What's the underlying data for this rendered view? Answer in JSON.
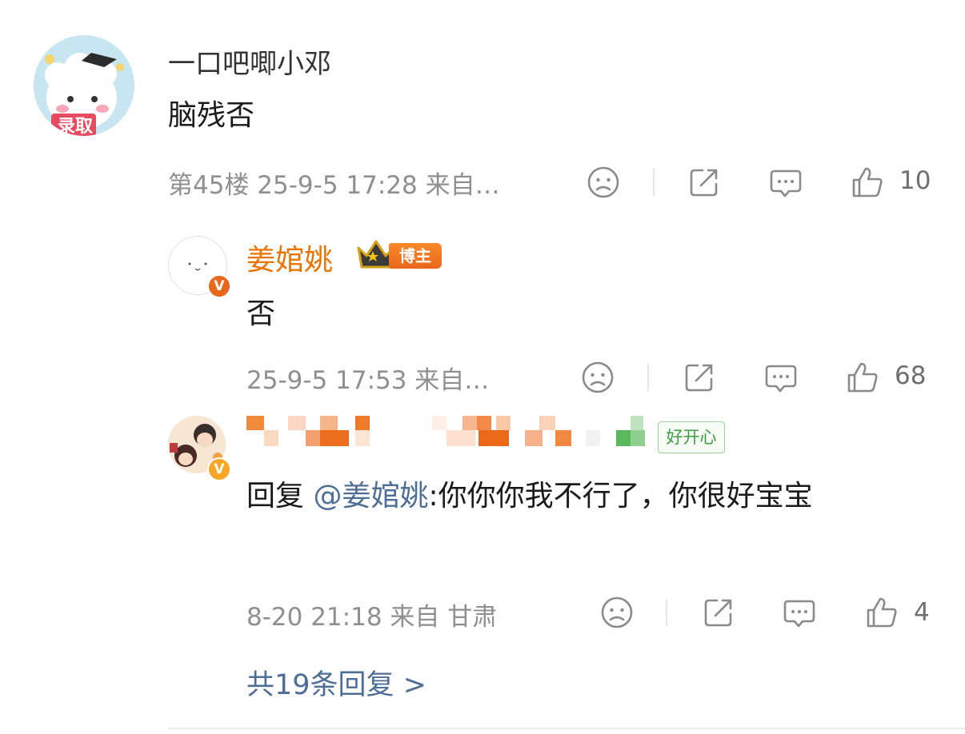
{
  "comment": {
    "author": "一口吧唧小邓",
    "avatar_text": "录取",
    "text": "脑残否",
    "meta": "第45楼 25-9-5 17:28 来自…",
    "like_count": "10"
  },
  "reply1": {
    "author": "姜婠姚",
    "badge_label": "博主",
    "text": "否",
    "meta": "25-9-5 17:53 来自…",
    "like_count": "68"
  },
  "reply2": {
    "tag_label": "好开心",
    "reply_prefix": "回复",
    "mention": "@姜婠姚",
    "text_suffix": ":你你你我不行了，你很好宝宝",
    "meta": "8-20 21:18 来自 甘肃",
    "like_count": "4"
  },
  "footer": {
    "more_replies_label": "共19条回复 >"
  },
  "colors": {
    "name_orange": "#eb7300",
    "link_blue": "#4f6e97",
    "meta_gray": "#8f8f8f",
    "tag_green": "#4caf50"
  },
  "icons": [
    "dislike-face-icon",
    "share-icon",
    "comment-icon",
    "like-thumb-icon"
  ]
}
